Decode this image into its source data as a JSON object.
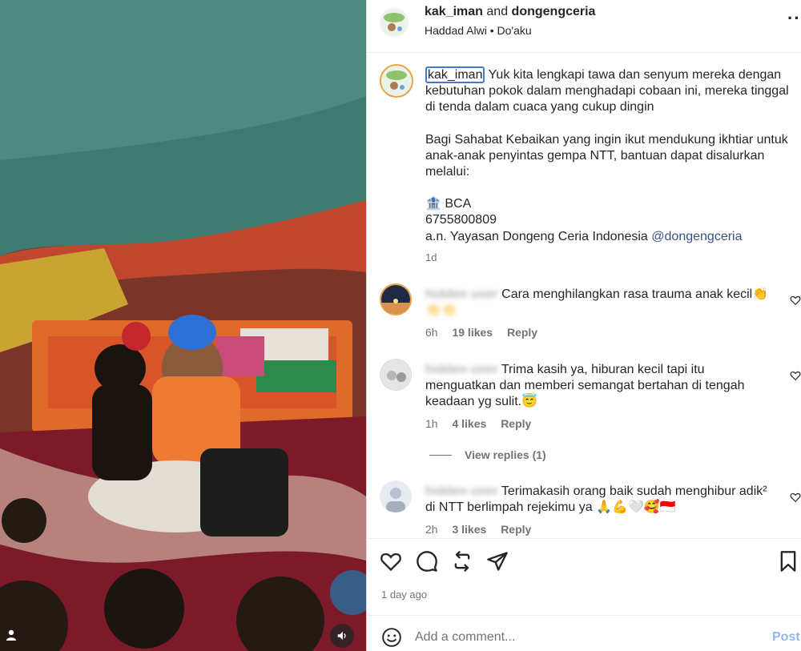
{
  "media": {
    "user_tag_icon": "user-tag-icon",
    "mute_icon": "speaker-icon"
  },
  "header": {
    "author": "kak_iman",
    "joiner": "and",
    "coauthor": "dongengceria",
    "subtitle_artist": "Haddad Alwi",
    "subtitle_separator": "•",
    "subtitle_song": "Do'aku",
    "more_icon": "more-options-icon"
  },
  "caption": {
    "username": "kak_iman",
    "line1": "Yuk kita lengkapi tawa dan senyum mereka dengan kebutuhan pokok dalam menghadapi cobaan ini, mereka tinggal di tenda dalam cuaca yang cukup dingin",
    "line2": "Bagi Sahabat Kebaikan yang ingin ikut mendukung ikhtiar untuk anak-anak penyintas gempa NTT, bantuan dapat disalurkan melalui:",
    "bank": "🏦 BCA",
    "account": "6755800809",
    "account_name": "a.n. Yayasan Dongeng Ceria Indonesia",
    "mention": "@dongengceria",
    "time": "1d"
  },
  "comments": [
    {
      "username": "hidden user",
      "text": "Cara menghilangkan rasa trauma anak kecil👏",
      "text2": "👏👏",
      "time": "6h",
      "likes": "19 likes",
      "reply": "Reply"
    },
    {
      "username": "hidden user",
      "text": "Trima kasih ya, hiburan kecil tapi itu menguatkan dan memberi semangat bertahan di tengah keadaan yg sulit.😇",
      "time": "1h",
      "likes": "4 likes",
      "reply": "Reply"
    },
    {
      "username": "hidden user",
      "text": "Terimakasih orang baik sudah menghibur adik² di NTT berlimpah rejekimu ya 🙏💪🤍🥰🇮🇩",
      "time": "2h",
      "likes": "3 likes",
      "reply": "Reply"
    }
  ],
  "view_replies": "View replies (1)",
  "actions": {
    "like_icon": "heart-icon",
    "comment_icon": "comment-icon",
    "share_icon": "repost-icon",
    "send_icon": "send-icon",
    "save_icon": "bookmark-icon"
  },
  "posted_ago": "1 day ago",
  "add_comment": {
    "placeholder": "Add a comment...",
    "post_label": "Post"
  }
}
